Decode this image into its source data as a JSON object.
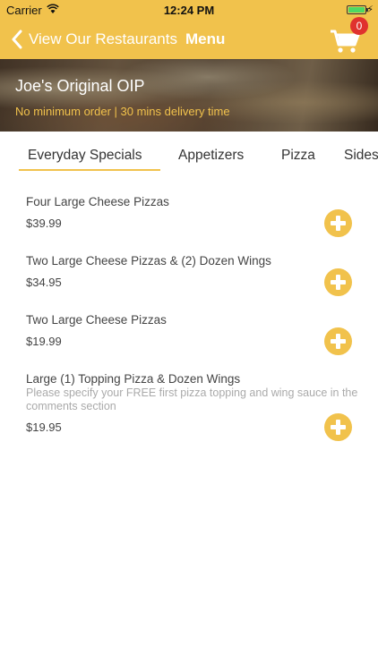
{
  "status_bar": {
    "carrier": "Carrier",
    "time": "12:24 PM"
  },
  "navbar": {
    "back_label": "View Our Restaurants",
    "title": "Menu",
    "cart_count": "0"
  },
  "restaurant": {
    "name": "Joe's Original OIP",
    "info": "No minimum order | 30 mins delivery time"
  },
  "tabs": [
    {
      "label": "Everyday Specials",
      "selected": true
    },
    {
      "label": "Appetizers"
    },
    {
      "label": "Pizza"
    },
    {
      "label": "Sides"
    }
  ],
  "items": [
    {
      "name": "Four Large Cheese Pizzas",
      "price": "$39.99"
    },
    {
      "name": "Two Large Cheese Pizzas & (2) Dozen Wings",
      "price": "$34.95"
    },
    {
      "name": "Two Large Cheese Pizzas",
      "price": "$19.99"
    },
    {
      "name": "Large (1) Topping Pizza & Dozen Wings",
      "description": "Please specify your FREE first pizza topping and wing sauce in the comments section",
      "price": "$19.95"
    }
  ],
  "colors": {
    "accent": "#f1c24c",
    "badge": "#e0322e",
    "battery": "#4cd964"
  }
}
